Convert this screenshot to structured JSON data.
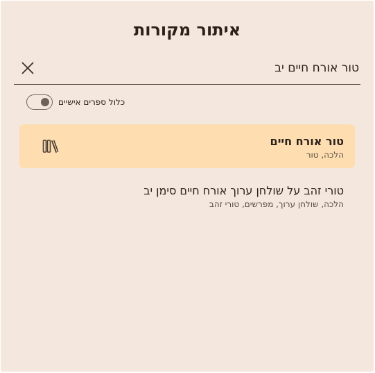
{
  "dialog": {
    "title": "איתור מקורות"
  },
  "search": {
    "value": "טור אורח חיים יב",
    "placeholder": ""
  },
  "toggle": {
    "label": "כלול ספרים אישיים",
    "state": "off"
  },
  "results": [
    {
      "title": "טור אורח חיים",
      "subtitle": "הלכה, טור",
      "selected": true,
      "icon": "library-icon"
    },
    {
      "title": "טורי זהב על שולחן ערוך אורח חיים סימן יב",
      "subtitle": "הלכה, שולחן ערוך, מפרשים, טורי זהב",
      "selected": false
    }
  ],
  "colors": {
    "background": "#f4e7dd",
    "selected_row": "#fedeb1",
    "text": "#2b211a"
  }
}
